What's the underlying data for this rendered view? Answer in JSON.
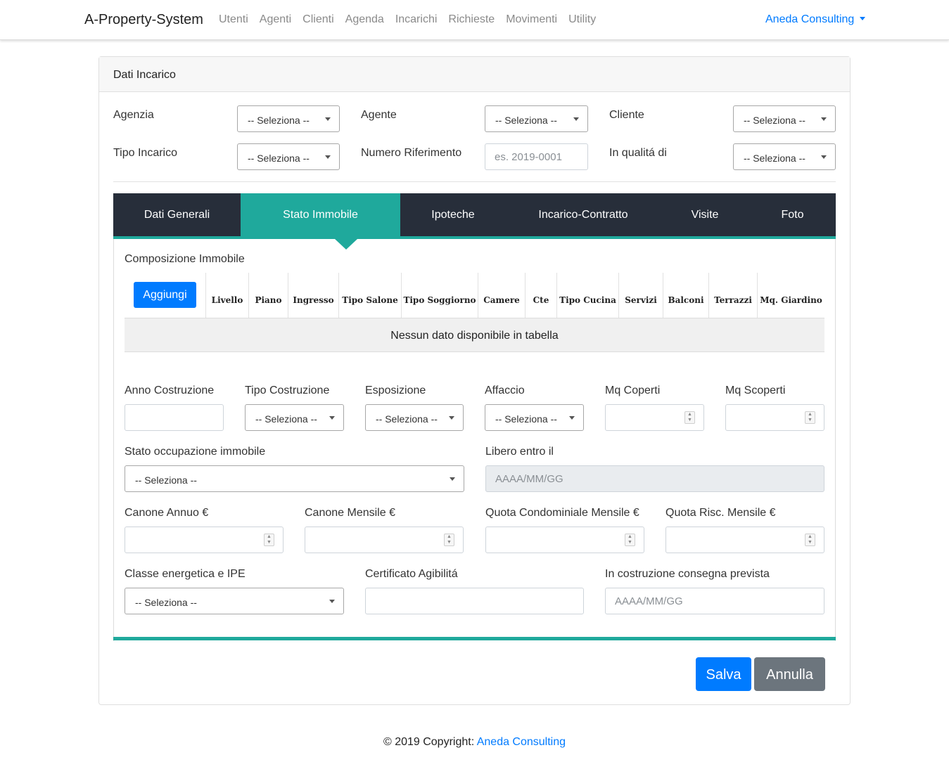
{
  "navbar": {
    "brand": "A-Property-System",
    "links": [
      "Utenti",
      "Agenti",
      "Clienti",
      "Agenda",
      "Incarichi",
      "Richieste",
      "Movimenti",
      "Utility"
    ],
    "account": "Aneda Consulting"
  },
  "card": {
    "header": "Dati Incarico",
    "agenzia": {
      "label": "Agenzia",
      "value": "-- Seleziona --"
    },
    "agente": {
      "label": "Agente",
      "value": "-- Seleziona --"
    },
    "cliente": {
      "label": "Cliente",
      "value": "-- Seleziona --"
    },
    "tipo_incarico": {
      "label": "Tipo Incarico",
      "value": "-- Seleziona --"
    },
    "numero_riferimento": {
      "label": "Numero Riferimento",
      "placeholder": "es. 2019-0001"
    },
    "in_qualita": {
      "label": "In qualitá di",
      "value": "-- Seleziona --"
    }
  },
  "tabs": [
    "Dati Generali",
    "Stato Immobile",
    "Ipoteche",
    "Incarico-Contratto",
    "Visite",
    "Foto"
  ],
  "active_tab": "Stato Immobile",
  "composizione": {
    "title": "Composizione Immobile",
    "add_button": "Aggiungi",
    "columns": [
      "Livello",
      "Piano",
      "Ingresso",
      "Tipo Salone",
      "Tipo Soggiorno",
      "Camere",
      "Cte",
      "Tipo Cucina",
      "Servizi",
      "Balconi",
      "Terrazzi",
      "Mq. Giardino"
    ],
    "empty_text": "Nessun dato disponibile in tabella"
  },
  "form": {
    "anno_costruzione": {
      "label": "Anno Costruzione"
    },
    "tipo_costruzione": {
      "label": "Tipo Costruzione",
      "value": "-- Seleziona --"
    },
    "esposizione": {
      "label": "Esposizione",
      "value": "-- Seleziona --"
    },
    "affaccio": {
      "label": "Affaccio",
      "value": "-- Seleziona --"
    },
    "mq_coperti": {
      "label": "Mq Coperti"
    },
    "mq_scoperti": {
      "label": "Mq Scoperti"
    },
    "stato_occupazione": {
      "label": "Stato occupazione immobile",
      "value": "-- Seleziona --"
    },
    "libero_entro": {
      "label": "Libero entro il",
      "placeholder": "AAAA/MM/GG"
    },
    "canone_annuo": {
      "label": "Canone Annuo €"
    },
    "canone_mensile": {
      "label": "Canone Mensile €"
    },
    "quota_condominiale": {
      "label": "Quota Condominiale Mensile €"
    },
    "quota_risc": {
      "label": "Quota Risc. Mensile €"
    },
    "classe_energetica": {
      "label": "Classe energetica e IPE",
      "value": "-- Seleziona --"
    },
    "certificato": {
      "label": "Certificato Agibilitá"
    },
    "consegna_prevista": {
      "label": "In costruzione consegna prevista",
      "placeholder": "AAAA/MM/GG"
    }
  },
  "buttons": {
    "save": "Salva",
    "cancel": "Annulla"
  },
  "footer": {
    "text": "© 2019 Copyright: ",
    "link": "Aneda Consulting"
  },
  "colors": {
    "primary": "#007bff",
    "teal": "#1fa99c",
    "dark": "#272e3a",
    "secondary": "#6c757d"
  }
}
